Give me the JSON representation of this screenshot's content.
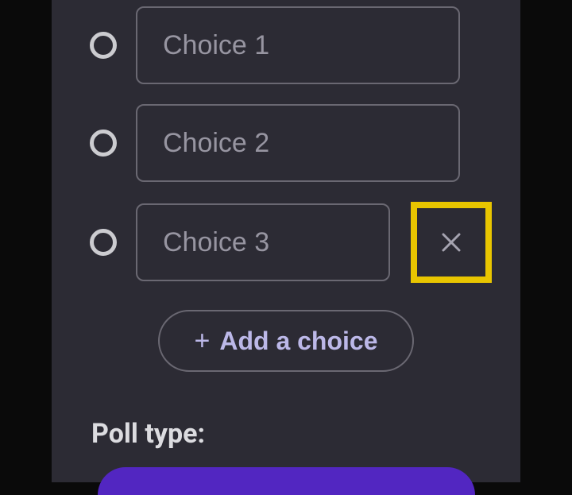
{
  "choices": {
    "choice1_placeholder": "Choice 1",
    "choice2_placeholder": "Choice 2",
    "choice3_placeholder": "Choice 3"
  },
  "add_choice_label": "Add a choice",
  "poll_type_label": "Poll type:"
}
